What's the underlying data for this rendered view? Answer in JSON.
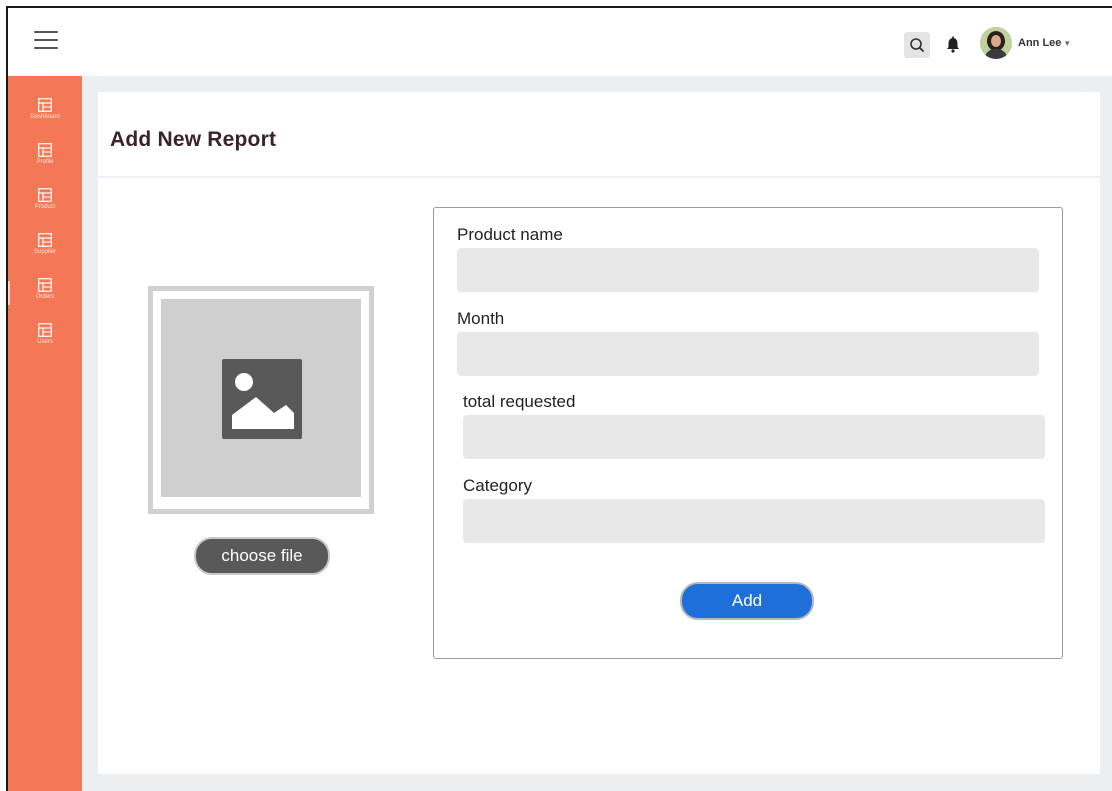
{
  "topbar": {
    "user_name": "Ann Lee",
    "user_caret": "▾"
  },
  "sidebar": {
    "items": [
      {
        "label": "Dashboard",
        "icon": "table-icon"
      },
      {
        "label": "Profile",
        "icon": "table-icon"
      },
      {
        "label": "Product",
        "icon": "table-icon"
      },
      {
        "label": "Supplier",
        "icon": "table-icon"
      },
      {
        "label": "Orders",
        "icon": "table-icon"
      },
      {
        "label": "Users",
        "icon": "table-icon"
      }
    ]
  },
  "page": {
    "title": "Add New Report"
  },
  "upload": {
    "choose_file_label": "choose file",
    "placeholder_icon": "image-placeholder-icon"
  },
  "form": {
    "fields": [
      {
        "label": "Product name",
        "value": ""
      },
      {
        "label": "Month",
        "value": ""
      },
      {
        "label": "total requested",
        "value": ""
      },
      {
        "label": "Category",
        "value": ""
      }
    ],
    "submit_label": "Add"
  },
  "colors": {
    "sidebar": "#f47756",
    "primary_button": "#1f6fdb",
    "title": "#3b2327"
  }
}
